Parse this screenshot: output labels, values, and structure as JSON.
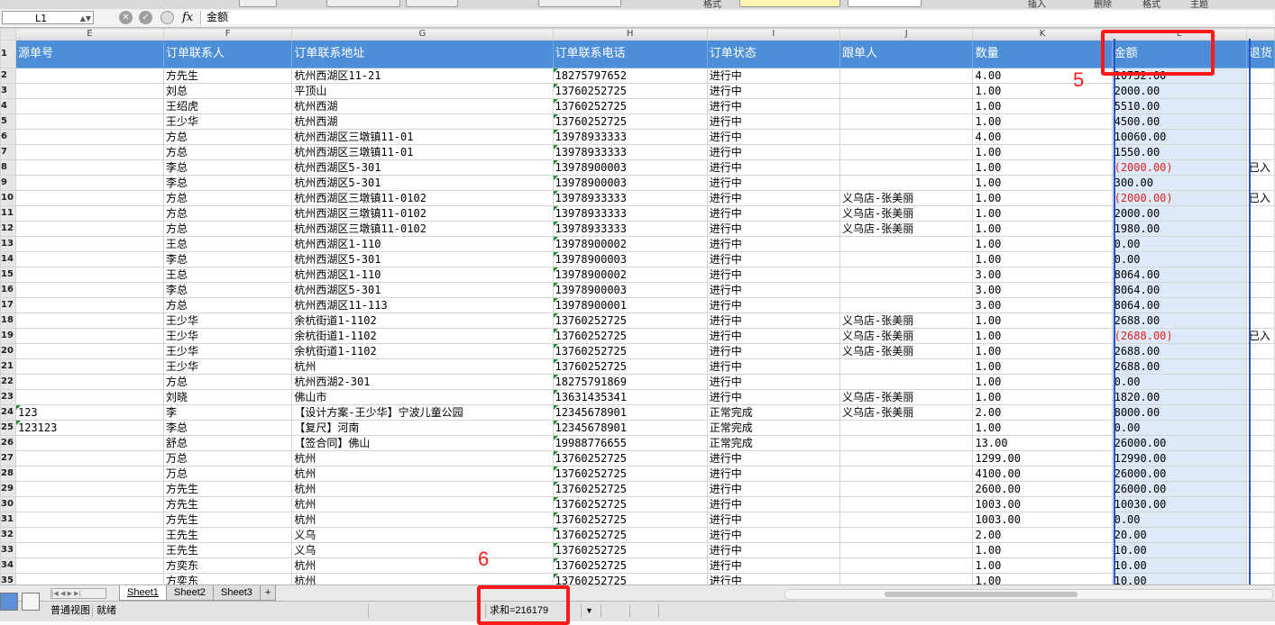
{
  "toolbar": {
    "labels": [
      "格式",
      "插入",
      "删除",
      "格式",
      "主题"
    ]
  },
  "formula_bar": {
    "name_box": "L1",
    "fx_label": "fx",
    "formula_value": "金额",
    "cancel_icon": "cancel-icon",
    "confirm_icon": "confirm-icon"
  },
  "columns": [
    "E",
    "F",
    "G",
    "H",
    "I",
    "J",
    "K",
    "L"
  ],
  "header_row": {
    "row_number": "1",
    "cells": [
      "源单号",
      "订单联系人",
      "订单联系地址",
      "订单联系电话",
      "订单状态",
      "跟单人",
      "数量",
      "金额",
      "退货"
    ]
  },
  "rows": [
    {
      "rn": "2",
      "e": "",
      "f": "方先生",
      "g": "杭州西湖区11-21",
      "h": "18275797652",
      "i": "进行中",
      "j": "",
      "k": "4.00",
      "l": "10752.00",
      "m": ""
    },
    {
      "rn": "3",
      "e": "",
      "f": "刘总",
      "g": "平顶山",
      "h": "13760252725",
      "i": "进行中",
      "j": "",
      "k": "1.00",
      "l": "2000.00",
      "m": ""
    },
    {
      "rn": "4",
      "e": "",
      "f": "王绍虎",
      "g": "杭州西湖",
      "h": "13760252725",
      "i": "进行中",
      "j": "",
      "k": "1.00",
      "l": "5510.00",
      "m": ""
    },
    {
      "rn": "5",
      "e": "",
      "f": "王少华",
      "g": "杭州西湖",
      "h": "13760252725",
      "i": "进行中",
      "j": "",
      "k": "1.00",
      "l": "4500.00",
      "m": ""
    },
    {
      "rn": "6",
      "e": "",
      "f": "方总",
      "g": "杭州西湖区三墩镇11-01",
      "h": "13978933333",
      "i": "进行中",
      "j": "",
      "k": "4.00",
      "l": "10060.00",
      "m": ""
    },
    {
      "rn": "7",
      "e": "",
      "f": "方总",
      "g": "杭州西湖区三墩镇11-01",
      "h": "13978933333",
      "i": "进行中",
      "j": "",
      "k": "1.00",
      "l": "1550.00",
      "m": ""
    },
    {
      "rn": "8",
      "e": "",
      "f": "李总",
      "g": "杭州西湖区5-301",
      "h": "13978900003",
      "i": "进行中",
      "j": "",
      "k": "1.00",
      "l": "(2000.00)",
      "m": "已入"
    },
    {
      "rn": "9",
      "e": "",
      "f": "李总",
      "g": "杭州西湖区5-301",
      "h": "13978900003",
      "i": "进行中",
      "j": "",
      "k": "1.00",
      "l": "300.00",
      "m": ""
    },
    {
      "rn": "10",
      "e": "",
      "f": "方总",
      "g": "杭州西湖区三墩镇11-0102",
      "h": "13978933333",
      "i": "进行中",
      "j": "义乌店-张美丽",
      "k": "1.00",
      "l": "(2000.00)",
      "m": "已入"
    },
    {
      "rn": "11",
      "e": "",
      "f": "方总",
      "g": "杭州西湖区三墩镇11-0102",
      "h": "13978933333",
      "i": "进行中",
      "j": "义乌店-张美丽",
      "k": "1.00",
      "l": "2000.00",
      "m": ""
    },
    {
      "rn": "12",
      "e": "",
      "f": "方总",
      "g": "杭州西湖区三墩镇11-0102",
      "h": "13978933333",
      "i": "进行中",
      "j": "义乌店-张美丽",
      "k": "1.00",
      "l": "1980.00",
      "m": ""
    },
    {
      "rn": "13",
      "e": "",
      "f": "王总",
      "g": "杭州西湖区1-110",
      "h": "13978900002",
      "i": "进行中",
      "j": "",
      "k": "1.00",
      "l": "0.00",
      "m": ""
    },
    {
      "rn": "14",
      "e": "",
      "f": "李总",
      "g": "杭州西湖区5-301",
      "h": "13978900003",
      "i": "进行中",
      "j": "",
      "k": "1.00",
      "l": "0.00",
      "m": ""
    },
    {
      "rn": "15",
      "e": "",
      "f": "王总",
      "g": "杭州西湖区1-110",
      "h": "13978900002",
      "i": "进行中",
      "j": "",
      "k": "3.00",
      "l": "8064.00",
      "m": ""
    },
    {
      "rn": "16",
      "e": "",
      "f": "李总",
      "g": "杭州西湖区5-301",
      "h": "13978900003",
      "i": "进行中",
      "j": "",
      "k": "3.00",
      "l": "8064.00",
      "m": ""
    },
    {
      "rn": "17",
      "e": "",
      "f": "方总",
      "g": "杭州西湖区11-113",
      "h": "13978900001",
      "i": "进行中",
      "j": "",
      "k": "3.00",
      "l": "8064.00",
      "m": ""
    },
    {
      "rn": "18",
      "e": "",
      "f": "王少华",
      "g": "余杭街道1-1102",
      "h": "13760252725",
      "i": "进行中",
      "j": "义乌店-张美丽",
      "k": "1.00",
      "l": "2688.00",
      "m": ""
    },
    {
      "rn": "19",
      "e": "",
      "f": "王少华",
      "g": "余杭街道1-1102",
      "h": "13760252725",
      "i": "进行中",
      "j": "义乌店-张美丽",
      "k": "1.00",
      "l": "(2688.00)",
      "m": "已入"
    },
    {
      "rn": "20",
      "e": "",
      "f": "王少华",
      "g": "余杭街道1-1102",
      "h": "13760252725",
      "i": "进行中",
      "j": "义乌店-张美丽",
      "k": "1.00",
      "l": "2688.00",
      "m": ""
    },
    {
      "rn": "21",
      "e": "",
      "f": "王少华",
      "g": "杭州",
      "h": "13760252725",
      "i": "进行中",
      "j": "",
      "k": "1.00",
      "l": "2688.00",
      "m": ""
    },
    {
      "rn": "22",
      "e": "",
      "f": "方总",
      "g": "杭州西湖2-301",
      "h": "18275791869",
      "i": "进行中",
      "j": "",
      "k": "1.00",
      "l": "0.00",
      "m": ""
    },
    {
      "rn": "23",
      "e": "",
      "f": "刘晓",
      "g": "佛山市",
      "h": "13631435341",
      "i": "进行中",
      "j": "义乌店-张美丽",
      "k": "1.00",
      "l": "1820.00",
      "m": ""
    },
    {
      "rn": "24",
      "e": "123",
      "f": "李",
      "g": "【设计方案-王少华】宁波儿童公园",
      "h": "12345678901",
      "i": "正常完成",
      "j": "义乌店-张美丽",
      "k": "2.00",
      "l": "8000.00",
      "m": ""
    },
    {
      "rn": "25",
      "e": "123123",
      "f": "李总",
      "g": "【复尺】河南",
      "h": "12345678901",
      "i": "正常完成",
      "j": "",
      "k": "1.00",
      "l": "0.00",
      "m": ""
    },
    {
      "rn": "26",
      "e": "",
      "f": "舒总",
      "g": "【签合同】佛山",
      "h": "19988776655",
      "i": "正常完成",
      "j": "",
      "k": "13.00",
      "l": "26000.00",
      "m": ""
    },
    {
      "rn": "27",
      "e": "",
      "f": "万总",
      "g": "杭州",
      "h": "13760252725",
      "i": "进行中",
      "j": "",
      "k": "1299.00",
      "l": "12990.00",
      "m": ""
    },
    {
      "rn": "28",
      "e": "",
      "f": "万总",
      "g": "杭州",
      "h": "13760252725",
      "i": "进行中",
      "j": "",
      "k": "4100.00",
      "l": "26000.00",
      "m": ""
    },
    {
      "rn": "29",
      "e": "",
      "f": "方先生",
      "g": "杭州",
      "h": "13760252725",
      "i": "进行中",
      "j": "",
      "k": "2600.00",
      "l": "26000.00",
      "m": ""
    },
    {
      "rn": "30",
      "e": "",
      "f": "方先生",
      "g": "杭州",
      "h": "13760252725",
      "i": "进行中",
      "j": "",
      "k": "1003.00",
      "l": "10030.00",
      "m": ""
    },
    {
      "rn": "31",
      "e": "",
      "f": "方先生",
      "g": "杭州",
      "h": "13760252725",
      "i": "进行中",
      "j": "",
      "k": "1003.00",
      "l": "0.00",
      "m": ""
    },
    {
      "rn": "32",
      "e": "",
      "f": "王先生",
      "g": "义乌",
      "h": "13760252725",
      "i": "进行中",
      "j": "",
      "k": "2.00",
      "l": "20.00",
      "m": ""
    },
    {
      "rn": "33",
      "e": "",
      "f": "王先生",
      "g": "义乌",
      "h": "13760252725",
      "i": "进行中",
      "j": "",
      "k": "1.00",
      "l": "10.00",
      "m": ""
    },
    {
      "rn": "34",
      "e": "",
      "f": "方奕东",
      "g": "杭州",
      "h": "13760252725",
      "i": "进行中",
      "j": "",
      "k": "1.00",
      "l": "10.00",
      "m": ""
    },
    {
      "rn": "35",
      "e": "",
      "f": "方奕东",
      "g": "杭州",
      "h": "13760252725",
      "i": "进行中",
      "j": "",
      "k": "1.00",
      "l": "10.00",
      "m": ""
    }
  ],
  "annotations": {
    "box1_number": "5",
    "box2_number": "6"
  },
  "sheet_tabs": [
    "Sheet1",
    "Sheet2",
    "Sheet3"
  ],
  "add_sheet_label": "+",
  "statusbar": {
    "view_mode": "普通视图",
    "ready": "就绪",
    "sum": "求和=216179"
  },
  "colors": {
    "header_blue": "#4d8ed8",
    "annotation_red": "#ff1a1a",
    "selection_blue": "#2a55c8",
    "negative_red": "#e02020"
  }
}
